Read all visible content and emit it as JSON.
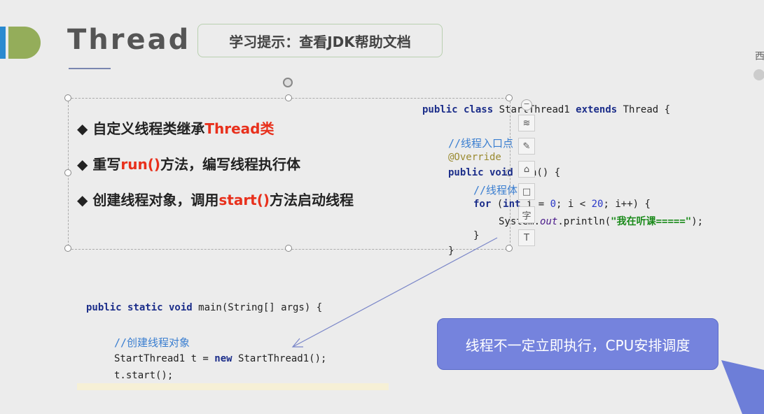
{
  "slide": {
    "title": "Thread",
    "tip": "学习提示：查看JDK帮助文档",
    "bullets": [
      {
        "marker": "◆",
        "pre": "自定义线程类继承",
        "red": "Thread类",
        "post": ""
      },
      {
        "marker": "◆",
        "pre": "重写",
        "red": "run()",
        "post": "方法，编写线程执行体"
      },
      {
        "marker": "◆",
        "pre": "创建线程对象，调用",
        "red": "start()",
        "post": "方法启动线程"
      }
    ],
    "callout": "线程不一定立即执行，CPU安排调度",
    "colors": {
      "accent_red": "#e8301c",
      "callout_bg": "#7583dd",
      "logo_green": "#94ad5a",
      "logo_blue": "#2a8ad0"
    }
  },
  "class_code": {
    "l1_kw1": "public class",
    "l1_name": " StartThread1 ",
    "l1_kw2": "extends",
    "l1_rest": " Thread {",
    "l2_comment": "//线程入口点",
    "l3_annotation": "@Override",
    "l4_kw": "public void",
    "l4_rest": " run() {",
    "l5_comment": "//线程体",
    "l6_kw1": "for",
    "l6_a": " (",
    "l6_kw2": "int",
    "l6_b": " i = ",
    "l6_n1": "0",
    "l6_c": "; i < ",
    "l6_n2": "20",
    "l6_d": "; i++) {",
    "l7_a": "System.",
    "l7_out": "out",
    "l7_b": ".println(",
    "l7_str": "\"我在听课=====\"",
    "l7_c": ");",
    "l8": "}",
    "l9": "}"
  },
  "main_code": {
    "l1_kw": "public static void",
    "l1_rest": " main(String[] args) {",
    "l2_comment": "//创建线程对象",
    "l3_a": "StartThread1 t = ",
    "l3_kw": "new",
    "l3_b": " StartThread1();",
    "l4": "t.start();"
  },
  "toolbar": {
    "icons": [
      "collapse-icon",
      "layers-icon",
      "pen-icon",
      "eraser-icon",
      "rectangle-icon",
      "text-icon",
      "textbox-icon"
    ],
    "text_glyph": "字",
    "textbox_glyph": "T"
  },
  "edge": {
    "char": "西"
  }
}
